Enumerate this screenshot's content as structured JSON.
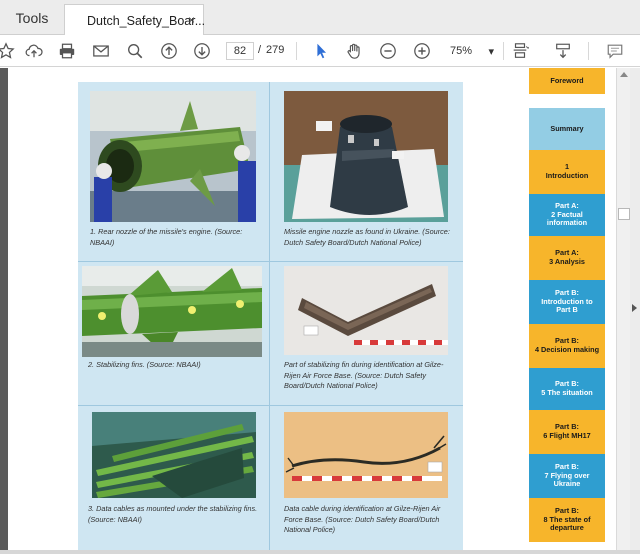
{
  "tabs": {
    "tools_label": "Tools",
    "document_label": "Dutch_Safety_Boar...",
    "close_glyph": "×"
  },
  "toolbar": {
    "current_page": "82",
    "page_separator": "/",
    "total_pages": "279",
    "zoom": "75%",
    "zoom_caret": "▾"
  },
  "figures": [
    {
      "id": "rear-nozzle",
      "caption": "1. Rear nozzle of the missile's engine. (Source: NBAAI)"
    },
    {
      "id": "missile-engine-nozzle",
      "caption": "Missile engine nozzle as found in Ukraine. (Source: Dutch Safety Board/Dutch National Police)"
    },
    {
      "id": "stabilizing-fins",
      "caption": "2. Stabilizing fins. (Source: NBAAI)"
    },
    {
      "id": "stabilizing-fin-part",
      "caption": "Part of stabilizing fin during identification at Gilze-Rijen Air Force Base. (Source: Dutch Safety Board/Dutch National Police)"
    },
    {
      "id": "data-cables-mounted",
      "caption": "3. Data cables as mounted under the stabilizing fins. (Source: NBAAI)"
    },
    {
      "id": "data-cable-identification",
      "caption": "Data cable during identification at Gilze-Rijen Air Force Base. (Source: Dutch Safety Board/Dutch National Police)"
    }
  ],
  "nav": {
    "items": [
      {
        "label": "Foreword",
        "color": "#f7b52b",
        "text_color": "#1a1a1a"
      },
      {
        "label": "Summary",
        "color": "#93cde4",
        "text_color": "#1a1a1a"
      },
      {
        "label": "1\nIntroduction",
        "color": "#f7b52b",
        "text_color": "#1a1a1a"
      },
      {
        "label": "Part A:\n2 Factual\ninformation",
        "color": "#2f9ed0",
        "text_color": "#ffffff"
      },
      {
        "label": "Part A:\n3 Analysis",
        "color": "#f7b52b",
        "text_color": "#1a1a1a"
      },
      {
        "label": "Part B:\nIntroduction to\nPart B",
        "color": "#2f9ed0",
        "text_color": "#ffffff"
      },
      {
        "label": "Part B:\n4 Decision making",
        "color": "#f7b52b",
        "text_color": "#1a1a1a"
      },
      {
        "label": "Part B:\n5 The situation",
        "color": "#2f9ed0",
        "text_color": "#ffffff"
      },
      {
        "label": "Part B:\n6 Flight MH17",
        "color": "#f7b52b",
        "text_color": "#1a1a1a"
      },
      {
        "label": "Part B:\n7 Flying over\nUkraine",
        "color": "#2f9ed0",
        "text_color": "#ffffff"
      },
      {
        "label": "Part B:\n8 The state of\ndeparture",
        "color": "#f7b52b",
        "text_color": "#1a1a1a"
      }
    ]
  },
  "icons": {
    "accent": "#2f6fd6",
    "names": [
      "star-icon",
      "cloud-upload-icon",
      "print-icon",
      "mail-icon",
      "search-icon",
      "page-up-icon",
      "page-down-icon",
      "select-cursor-icon",
      "hand-icon",
      "zoom-out-icon",
      "zoom-in-icon",
      "fit-page-icon",
      "scroll-mode-icon",
      "comment-icon"
    ]
  }
}
